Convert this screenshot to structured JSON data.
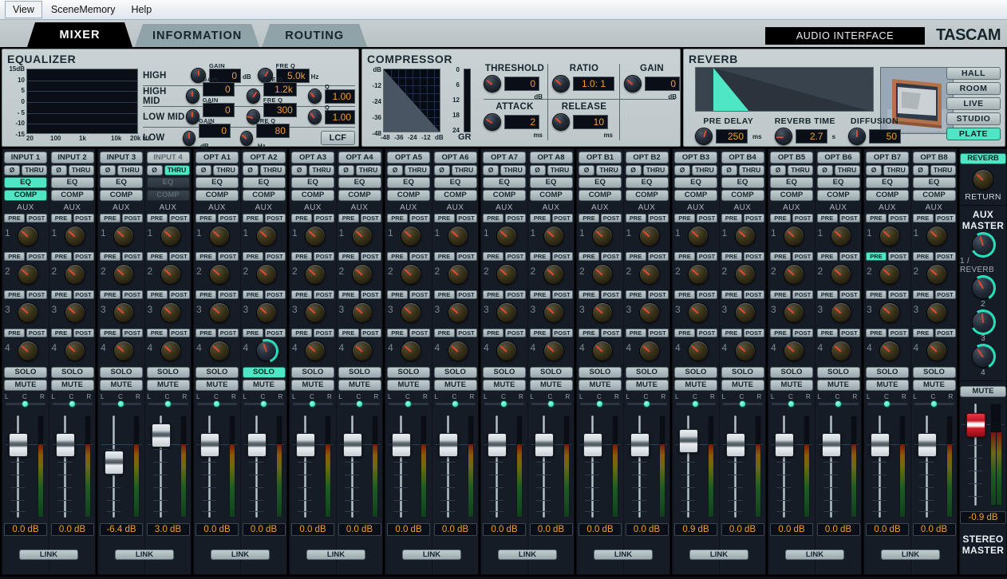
{
  "menubar": {
    "items": [
      "View",
      "SceneMemory",
      "Help"
    ]
  },
  "tabs": [
    {
      "label": "MIXER",
      "active": true
    },
    {
      "label": "INFORMATION",
      "active": false
    },
    {
      "label": "ROUTING",
      "active": false
    }
  ],
  "header": {
    "device": "AUDIO INTERFACE",
    "brand": "TASCAM"
  },
  "equalizer": {
    "title": "EQUALIZER",
    "graph": {
      "y_labels": [
        "15dB",
        "10",
        "5",
        "0",
        "- 5",
        "-10",
        "-15"
      ],
      "x_labels": [
        "20",
        "100",
        "1k",
        "10k",
        "20k Hz"
      ]
    },
    "bands": [
      {
        "name": "HIGH",
        "gain_label": "GAIN",
        "gain": "0",
        "gain_unit": "dB",
        "freq_label": "FRE Q",
        "freq": "5.0k",
        "freq_unit": "Hz",
        "q_label": "",
        "q": ""
      },
      {
        "name": "HIGH MID",
        "gain_label": "GAIN",
        "gain": "0",
        "gain_unit": "dB",
        "freq_label": "FRE Q",
        "freq": "1.2k",
        "freq_unit": "Hz",
        "q_label": "Q",
        "q": "1.00"
      },
      {
        "name": "LOW MID",
        "gain_label": "GAIN",
        "gain": "0",
        "gain_unit": "dB",
        "freq_label": "FRE Q",
        "freq": "300",
        "freq_unit": "Hz",
        "q_label": "Q",
        "q": "1.00"
      },
      {
        "name": "LOW",
        "gain_label": "GAIN",
        "gain": "0",
        "gain_unit": "dB",
        "freq_label": "FRE Q",
        "freq": "80",
        "freq_unit": "Hz",
        "q_label": "",
        "q": ""
      }
    ],
    "lcf_label": "LCF"
  },
  "compressor": {
    "title": "COMPRESSOR",
    "graph": {
      "y_labels": [
        "dB",
        "-12",
        "-24",
        "-36",
        "-48"
      ],
      "x_labels": [
        "-48",
        "-36",
        "-24",
        "-12",
        "dB"
      ]
    },
    "gr_meter": {
      "label": "GR",
      "scale": [
        "0",
        "6",
        "12",
        "18",
        "24"
      ]
    },
    "controls": [
      {
        "name": "THRESHOLD",
        "value": "0",
        "unit": "dB"
      },
      {
        "name": "RATIO",
        "value": "1.0: 1",
        "unit": ""
      },
      {
        "name": "GAIN",
        "value": "0",
        "unit": "dB"
      },
      {
        "name": "ATTACK",
        "value": "2",
        "unit": "ms"
      },
      {
        "name": "RELEASE",
        "value": "10",
        "unit": "ms"
      }
    ]
  },
  "reverb": {
    "title": "REVERB",
    "controls": [
      {
        "name": "PRE DELAY",
        "value": "250",
        "unit": "ms"
      },
      {
        "name": "REVERB TIME",
        "value": "2.7",
        "unit": "s"
      },
      {
        "name": "DIFFUSION",
        "value": "50",
        "unit": ""
      }
    ],
    "types": [
      {
        "label": "HALL",
        "active": false
      },
      {
        "label": "ROOM",
        "active": false
      },
      {
        "label": "LIVE",
        "active": false
      },
      {
        "label": "STUDIO",
        "active": false
      },
      {
        "label": "PLATE",
        "active": true
      }
    ]
  },
  "channel_common": {
    "phase_label": "Ø",
    "thru_label": "THRU",
    "eq_label": "EQ",
    "comp_label": "COMP",
    "aux_label": "AUX",
    "pre_label": "PRE",
    "post_label": "POST",
    "aux_numbers": [
      "1",
      "2",
      "3",
      "4"
    ],
    "solo_label": "SOLO",
    "mute_label": "MUTE",
    "pan_labels": [
      "L",
      "C",
      "R"
    ],
    "link_label": "LINK",
    "db_unit": "dB"
  },
  "channels": [
    {
      "name": "INPUT 1",
      "thru": false,
      "eq": true,
      "comp": true,
      "dim": false,
      "db": "0.0 dB",
      "fader": 40,
      "meter": 72,
      "solo_on": false,
      "aux4_on": false,
      "aux2_pre": false
    },
    {
      "name": "INPUT 2",
      "thru": false,
      "eq": false,
      "comp": false,
      "dim": false,
      "db": "0.0 dB",
      "fader": 40,
      "meter": 72,
      "solo_on": false,
      "aux4_on": false,
      "aux2_pre": false
    },
    {
      "name": "INPUT 3",
      "thru": false,
      "eq": false,
      "comp": false,
      "dim": false,
      "db": "-6.4 dB",
      "fader": 62,
      "meter": 72,
      "solo_on": false,
      "aux4_on": false,
      "aux2_pre": false
    },
    {
      "name": "INPUT 4",
      "thru": true,
      "eq": false,
      "comp": false,
      "dim": true,
      "db": "3.0 dB",
      "fader": 28,
      "meter": 72,
      "solo_on": false,
      "aux4_on": false,
      "aux2_pre": false
    },
    {
      "name": "OPT A1",
      "thru": false,
      "eq": false,
      "comp": false,
      "dim": false,
      "db": "0.0 dB",
      "fader": 40,
      "meter": 72,
      "solo_on": false,
      "aux4_on": false,
      "aux2_pre": false
    },
    {
      "name": "OPT A2",
      "thru": false,
      "eq": false,
      "comp": false,
      "dim": false,
      "db": "0.0 dB",
      "fader": 40,
      "meter": 72,
      "solo_on": true,
      "aux4_on": true,
      "aux2_pre": false
    },
    {
      "name": "OPT A3",
      "thru": false,
      "eq": false,
      "comp": false,
      "dim": false,
      "db": "0.0 dB",
      "fader": 40,
      "meter": 72,
      "solo_on": false,
      "aux4_on": false,
      "aux2_pre": false
    },
    {
      "name": "OPT A4",
      "thru": false,
      "eq": false,
      "comp": false,
      "dim": false,
      "db": "0.0 dB",
      "fader": 40,
      "meter": 72,
      "solo_on": false,
      "aux4_on": false,
      "aux2_pre": false
    },
    {
      "name": "OPT A5",
      "thru": false,
      "eq": false,
      "comp": false,
      "dim": false,
      "db": "0.0 dB",
      "fader": 40,
      "meter": 72,
      "solo_on": false,
      "aux4_on": false,
      "aux2_pre": false
    },
    {
      "name": "OPT A6",
      "thru": false,
      "eq": false,
      "comp": false,
      "dim": false,
      "db": "0.0 dB",
      "fader": 40,
      "meter": 72,
      "solo_on": false,
      "aux4_on": false,
      "aux2_pre": false
    },
    {
      "name": "OPT A7",
      "thru": false,
      "eq": false,
      "comp": false,
      "dim": false,
      "db": "0.0 dB",
      "fader": 40,
      "meter": 72,
      "solo_on": false,
      "aux4_on": false,
      "aux2_pre": false
    },
    {
      "name": "OPT A8",
      "thru": false,
      "eq": false,
      "comp": false,
      "dim": false,
      "db": "0.0 dB",
      "fader": 40,
      "meter": 72,
      "solo_on": false,
      "aux4_on": false,
      "aux2_pre": false
    },
    {
      "name": "OPT B1",
      "thru": false,
      "eq": false,
      "comp": false,
      "dim": false,
      "db": "0.0 dB",
      "fader": 40,
      "meter": 72,
      "solo_on": false,
      "aux4_on": false,
      "aux2_pre": false
    },
    {
      "name": "OPT B2",
      "thru": false,
      "eq": false,
      "comp": false,
      "dim": false,
      "db": "0.0 dB",
      "fader": 40,
      "meter": 72,
      "solo_on": false,
      "aux4_on": false,
      "aux2_pre": false
    },
    {
      "name": "OPT B3",
      "thru": false,
      "eq": false,
      "comp": false,
      "dim": false,
      "db": "0.9 dB",
      "fader": 35,
      "meter": 72,
      "solo_on": false,
      "aux4_on": false,
      "aux2_pre": false
    },
    {
      "name": "OPT B4",
      "thru": false,
      "eq": false,
      "comp": false,
      "dim": false,
      "db": "0.0 dB",
      "fader": 40,
      "meter": 72,
      "solo_on": false,
      "aux4_on": false,
      "aux2_pre": false
    },
    {
      "name": "OPT B5",
      "thru": false,
      "eq": false,
      "comp": false,
      "dim": false,
      "db": "0.0 dB",
      "fader": 40,
      "meter": 72,
      "solo_on": false,
      "aux4_on": false,
      "aux2_pre": false
    },
    {
      "name": "OPT B6",
      "thru": false,
      "eq": false,
      "comp": false,
      "dim": false,
      "db": "0.0 dB",
      "fader": 40,
      "meter": 72,
      "solo_on": false,
      "aux4_on": false,
      "aux2_pre": false
    },
    {
      "name": "OPT B7",
      "thru": false,
      "eq": false,
      "comp": false,
      "dim": false,
      "db": "0.0 dB",
      "fader": 40,
      "meter": 72,
      "solo_on": false,
      "aux4_on": false,
      "aux2_pre": true
    },
    {
      "name": "OPT B8",
      "thru": false,
      "eq": false,
      "comp": false,
      "dim": false,
      "db": "0.0 dB",
      "fader": 40,
      "meter": 72,
      "solo_on": false,
      "aux4_on": false,
      "aux2_pre": false
    }
  ],
  "master": {
    "reverb_label": "REVERB",
    "return_label": "RETURN",
    "aux_master_line1": "AUX",
    "aux_master_line2": "MASTER",
    "aux_knobs": [
      {
        "label": "1 / REVERB"
      },
      {
        "label": "2"
      },
      {
        "label": "3"
      },
      {
        "label": "4"
      }
    ],
    "mute_label": "MUTE",
    "db": "-0.9 dB",
    "stereo_line1": "STEREO",
    "stereo_line2": "MASTER"
  },
  "colors": {
    "accent_cyan": "#4fe6c6",
    "value_orange": "#f0a030",
    "panel_bg": "#c5cfd2",
    "strip_bg": "#161c25"
  }
}
